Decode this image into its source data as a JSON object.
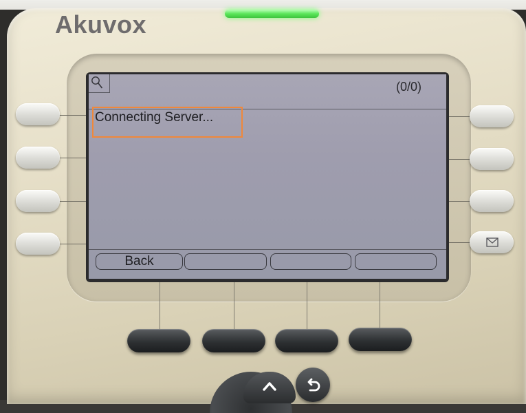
{
  "device": {
    "brand": "Akuvox"
  },
  "screen": {
    "counter": "(0/0)",
    "status_message": "Connecting Server...",
    "softkeys": [
      "Back",
      "",
      "",
      ""
    ]
  },
  "colors": {
    "led": "#5be65a",
    "highlight_box": "#f0883a",
    "lcd_background": "#a3a1b2"
  },
  "icons": {
    "search": "search-icon",
    "message": "envelope-icon",
    "up": "chevron-up-icon",
    "back": "back-arrow-icon"
  }
}
